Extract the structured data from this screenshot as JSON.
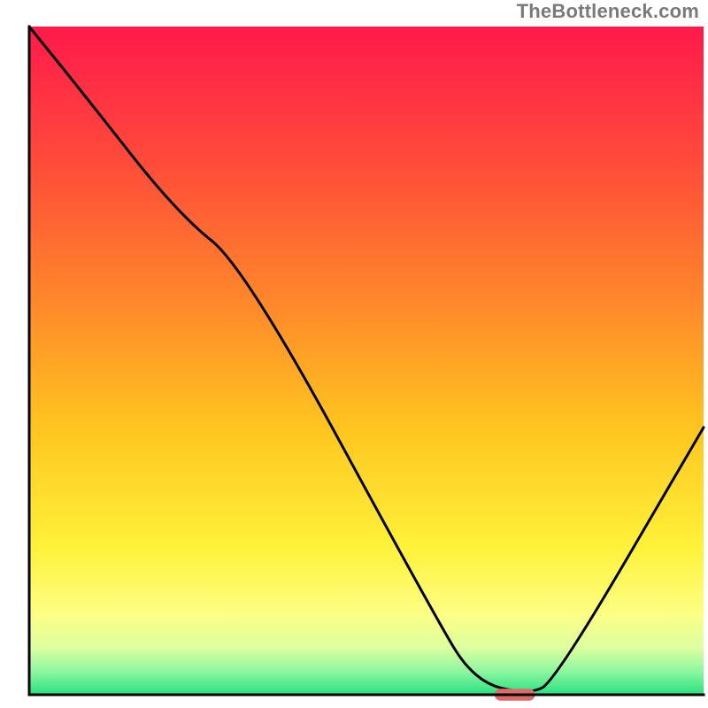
{
  "watermark": "TheBottleneck.com",
  "chart_data": {
    "type": "line",
    "title": "",
    "xlabel": "",
    "ylabel": "",
    "xlim": [
      0,
      100
    ],
    "ylim": [
      0,
      100
    ],
    "grid": false,
    "legend": false,
    "gradient_stops": [
      {
        "offset": 0.0,
        "color": "#ff1a4b"
      },
      {
        "offset": 0.2,
        "color": "#ff4a3a"
      },
      {
        "offset": 0.42,
        "color": "#ff8a2a"
      },
      {
        "offset": 0.6,
        "color": "#ffc51f"
      },
      {
        "offset": 0.78,
        "color": "#fff23a"
      },
      {
        "offset": 0.88,
        "color": "#fdff85"
      },
      {
        "offset": 0.93,
        "color": "#dcffa0"
      },
      {
        "offset": 0.965,
        "color": "#8ef7a0"
      },
      {
        "offset": 1.0,
        "color": "#27e07f"
      }
    ],
    "series": [
      {
        "name": "bottleneck-curve",
        "x": [
          0,
          8,
          22,
          32,
          60,
          66,
          74,
          78,
          100
        ],
        "y": [
          100,
          90,
          72,
          64,
          12,
          2,
          0,
          2,
          40
        ]
      }
    ],
    "marker": {
      "name": "optimal-point",
      "x": 72,
      "y": 0,
      "color": "#e06a6a",
      "width": 6,
      "height": 1.8,
      "rx": 2
    },
    "axes_color": "#000000",
    "axes_width": 3
  }
}
